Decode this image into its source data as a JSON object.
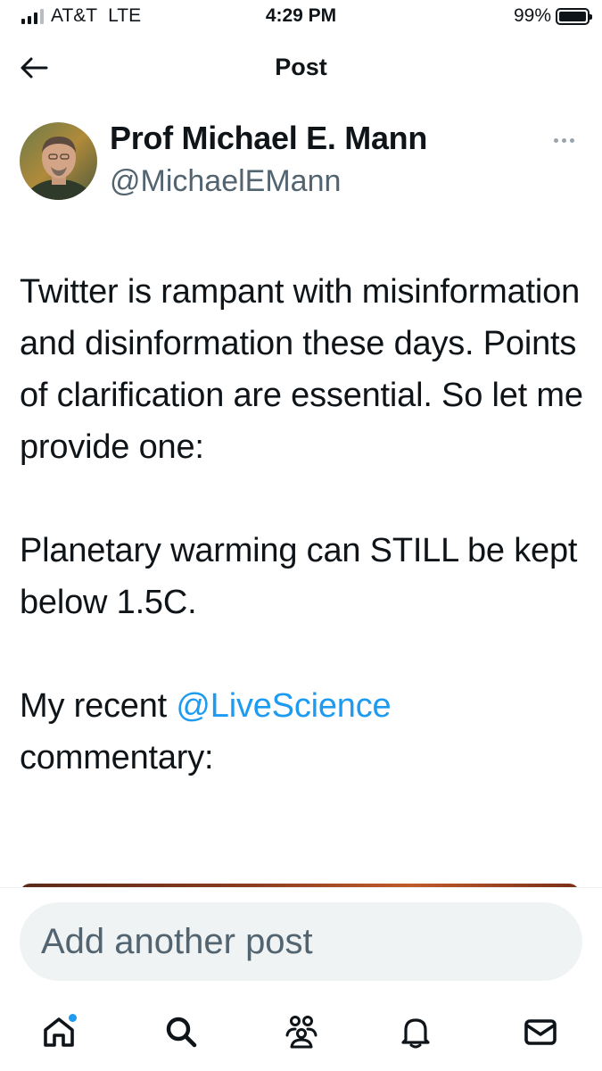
{
  "status_bar": {
    "carrier": "AT&T",
    "network": "LTE",
    "time": "4:29 PM",
    "battery": "99%",
    "battery_level": 0.99,
    "signal_bars": 3
  },
  "header": {
    "title": "Post",
    "back_icon": "arrow-left-icon"
  },
  "author": {
    "name": "Prof Michael E. Mann",
    "handle": "@MichaelEMann",
    "more_icon": "ellipsis-icon"
  },
  "tweet": {
    "paragraph1": "Twitter is rampant with misinformation and disinformation these days. Points of clarification are essential. So let me provide one:",
    "paragraph2": "Planetary warming can STILL be kept below 1.5C.",
    "paragraph3_prefix": "My recent ",
    "paragraph3_mention": "@LiveScience",
    "paragraph3_suffix": " commentary:"
  },
  "reply": {
    "placeholder": "Add another post"
  },
  "tab_bar": {
    "tabs": [
      {
        "icon": "home-icon",
        "has_notification_dot": true
      },
      {
        "icon": "search-icon"
      },
      {
        "icon": "communities-icon"
      },
      {
        "icon": "bell-icon"
      },
      {
        "icon": "mail-icon"
      }
    ]
  },
  "colors": {
    "accent": "#1d9bf0",
    "text": "#0f1419",
    "secondary_text": "#536471",
    "input_bg": "#eff3f4"
  }
}
